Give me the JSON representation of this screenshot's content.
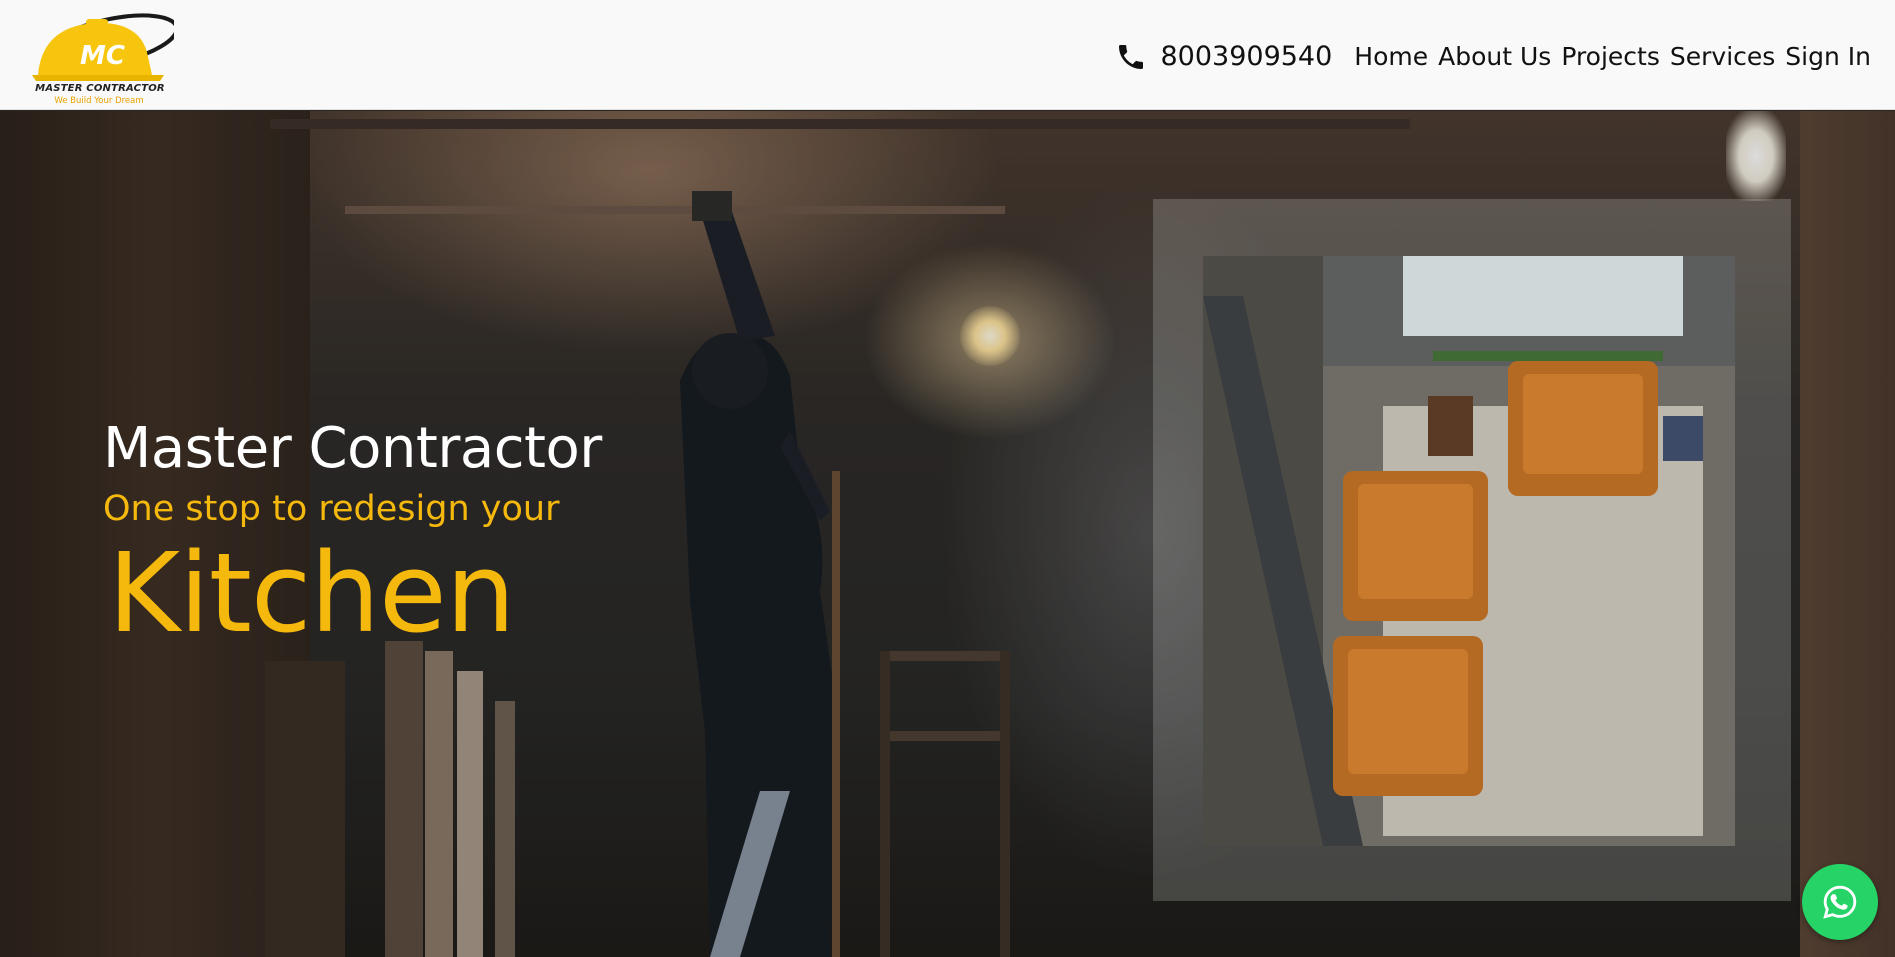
{
  "header": {
    "logo": {
      "name": "MASTER CONTRACTOR",
      "tagline": "We Build Your Dream",
      "monogram": "MC"
    },
    "phone": {
      "icon": "phone-icon",
      "number": "8003909540"
    },
    "nav": [
      {
        "label": "Home"
      },
      {
        "label": "About Us"
      },
      {
        "label": "Projects"
      },
      {
        "label": "Services"
      },
      {
        "label": "Sign In"
      }
    ]
  },
  "hero": {
    "title": "Master Contractor",
    "subtitle": "One stop to redesign your",
    "rotating_word": "Kitchen"
  },
  "floating": {
    "whatsapp_icon": "whatsapp-icon"
  },
  "colors": {
    "accent": "#f5b80c",
    "header_bg": "#f9f9f9",
    "whatsapp": "#25d366",
    "hero_title": "#ffffff"
  }
}
